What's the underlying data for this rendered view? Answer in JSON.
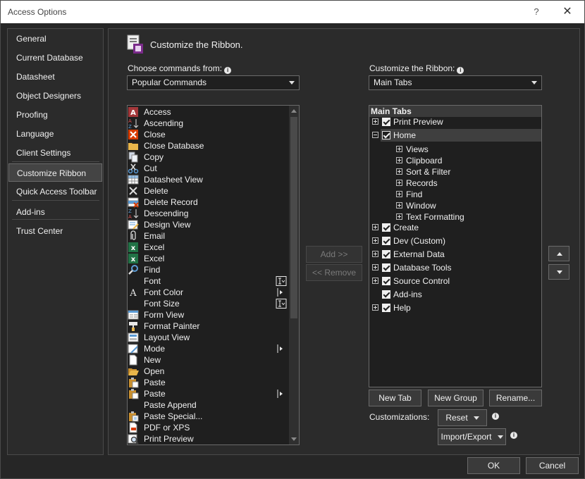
{
  "window": {
    "title": "Access Options",
    "help_glyph": "?",
    "close_glyph": "✕"
  },
  "nav": {
    "items": [
      {
        "label": "General"
      },
      {
        "label": "Current Database"
      },
      {
        "label": "Datasheet"
      },
      {
        "label": "Object Designers"
      },
      {
        "label": "Proofing"
      },
      {
        "label": "Language"
      },
      {
        "label": "Client Settings"
      },
      {
        "label": "Customize Ribbon",
        "selected": true
      },
      {
        "label": "Quick Access Toolbar"
      },
      {
        "label": "Add-ins"
      },
      {
        "label": "Trust Center"
      }
    ]
  },
  "header": {
    "title": "Customize the Ribbon.",
    "icon": "customize-ribbon-icon"
  },
  "left": {
    "label": "Choose commands from:",
    "info_glyph": "i",
    "combo_value": "Popular Commands",
    "commands": [
      {
        "label": "Access",
        "icon": "access-icon"
      },
      {
        "label": "Ascending",
        "icon": "sort-ascending-icon"
      },
      {
        "label": "Close",
        "icon": "close-red-icon"
      },
      {
        "label": "Close Database",
        "icon": "folder-icon"
      },
      {
        "label": "Copy",
        "icon": "copy-icon"
      },
      {
        "label": "Cut",
        "icon": "scissors-icon"
      },
      {
        "label": "Datasheet View",
        "icon": "datasheet-icon"
      },
      {
        "label": "Delete",
        "icon": "x-delete-icon"
      },
      {
        "label": "Delete Record",
        "icon": "delete-record-icon"
      },
      {
        "label": "Descending",
        "icon": "sort-descending-icon"
      },
      {
        "label": "Design View",
        "icon": "design-view-icon"
      },
      {
        "label": "Email",
        "icon": "attachment-icon"
      },
      {
        "label": "Excel",
        "icon": "excel-icon"
      },
      {
        "label": "Excel",
        "icon": "excel-icon"
      },
      {
        "label": "Find",
        "icon": "find-icon"
      },
      {
        "label": "Font",
        "icon": "",
        "sub": "font-picker-icon"
      },
      {
        "label": "Font Color",
        "icon": "font-color-icon",
        "sub": "submenu-arrow-icon"
      },
      {
        "label": "Font Size",
        "icon": "",
        "sub": "font-picker-icon"
      },
      {
        "label": "Form View",
        "icon": "form-view-icon"
      },
      {
        "label": "Format Painter",
        "icon": "format-painter-icon"
      },
      {
        "label": "Layout View",
        "icon": "layout-view-icon"
      },
      {
        "label": "Mode",
        "icon": "mode-icon",
        "sub": "submenu-arrow-icon"
      },
      {
        "label": "New",
        "icon": "new-doc-icon"
      },
      {
        "label": "Open",
        "icon": "open-folder-icon"
      },
      {
        "label": "Paste",
        "icon": "paste-icon"
      },
      {
        "label": "Paste",
        "icon": "paste-icon",
        "sub": "submenu-arrow-icon"
      },
      {
        "label": "Paste Append",
        "icon": ""
      },
      {
        "label": "Paste Special...",
        "icon": "paste-special-icon"
      },
      {
        "label": "PDF or XPS",
        "icon": "pdf-icon"
      },
      {
        "label": "Print Preview",
        "icon": "print-preview-icon"
      }
    ]
  },
  "middle": {
    "add_label": "Add >>",
    "remove_label": "<< Remove"
  },
  "right": {
    "label": "Customize the Ribbon:",
    "info_glyph": "i",
    "combo_value": "Main Tabs",
    "tree_header": "Main Tabs",
    "tree": [
      {
        "label": "Print Preview",
        "level": 0,
        "expander": "plus",
        "checked": true
      },
      {
        "label": "Home",
        "level": 0,
        "expander": "minus",
        "checked": true,
        "selected": true
      },
      {
        "label": "Views",
        "level": 1,
        "expander": "plus"
      },
      {
        "label": "Clipboard",
        "level": 1,
        "expander": "plus"
      },
      {
        "label": "Sort & Filter",
        "level": 1,
        "expander": "plus"
      },
      {
        "label": "Records",
        "level": 1,
        "expander": "plus"
      },
      {
        "label": "Find",
        "level": 1,
        "expander": "plus"
      },
      {
        "label": "Window",
        "level": 1,
        "expander": "plus"
      },
      {
        "label": "Text Formatting",
        "level": 1,
        "expander": "plus"
      },
      {
        "label": "Create",
        "level": 0,
        "expander": "plus",
        "checked": true
      },
      {
        "label": "Dev (Custom)",
        "level": 0,
        "expander": "plus",
        "checked": true
      },
      {
        "label": "External Data",
        "level": 0,
        "expander": "plus",
        "checked": true
      },
      {
        "label": "Database Tools",
        "level": 0,
        "expander": "plus",
        "checked": true
      },
      {
        "label": "Source Control",
        "level": 0,
        "expander": "plus",
        "checked": true
      },
      {
        "label": "Add-ins",
        "level": 0,
        "expander": "",
        "checked": true
      },
      {
        "label": "Help",
        "level": 0,
        "expander": "plus",
        "checked": true
      }
    ],
    "new_tab_label": "New Tab",
    "new_group_label": "New Group",
    "rename_label": "Rename...",
    "customizations_label": "Customizations:",
    "reset_label": "Reset",
    "import_export_label": "Import/Export"
  },
  "footer": {
    "ok_label": "OK",
    "cancel_label": "Cancel"
  }
}
